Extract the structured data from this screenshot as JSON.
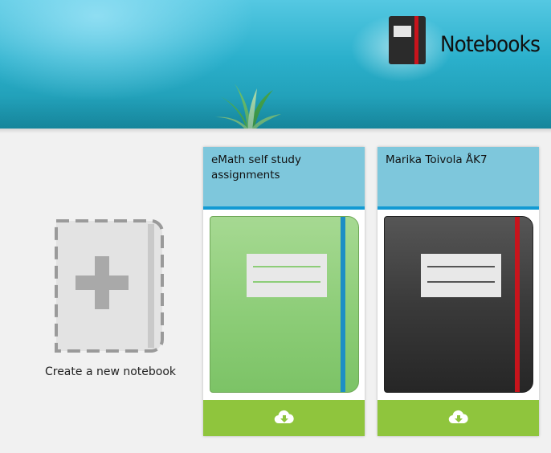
{
  "header": {
    "title": "Notebooks",
    "logo_icon": "notebook-icon",
    "banner_icon": "plant-icon"
  },
  "create": {
    "label": "Create a new notebook",
    "icon": "add-notebook-icon"
  },
  "notebooks": [
    {
      "title": "eMath self study assignments",
      "cover_color": "#8dcd78",
      "band_color": "#1d8fc5",
      "label_line_color": "#8dcd78",
      "download_icon": "cloud-download-icon"
    },
    {
      "title": "Marika Toivola ÅK7",
      "cover_color": "#3a3a3a",
      "band_color": "#c8141c",
      "label_line_color": "#555555",
      "download_icon": "cloud-download-icon"
    }
  ],
  "colors": {
    "card_header": "#7ec7dc",
    "card_header_border": "#129ad3",
    "card_footer": "#8fc53d",
    "page_background": "#f1f1f1"
  }
}
